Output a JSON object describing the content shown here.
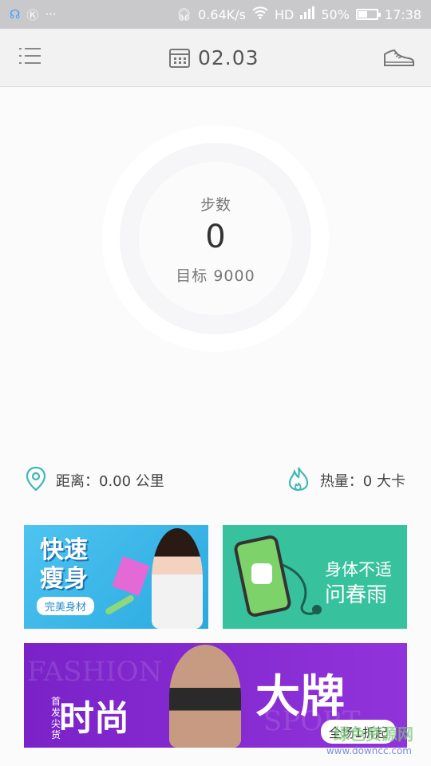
{
  "status_bar": {
    "left_icons": [
      "headset-status-icon",
      "k-icon",
      "more-dots-icon"
    ],
    "net_speed": "0.64K/s",
    "hd_label": "HD",
    "battery_pct": "50%",
    "battery_level": 0.5,
    "time": "17:38",
    "dots": "···"
  },
  "header": {
    "date": "02.03"
  },
  "steps": {
    "label": "步数",
    "value": "0",
    "goal": "目标 9000"
  },
  "stats": {
    "distance": "距离：0.00 公里",
    "calories": "热量：0 大卡"
  },
  "banners": {
    "b1": {
      "title_line1": "快速",
      "title_line2": "瘦身",
      "subtitle": "完美身材"
    },
    "b2": {
      "line1": "身体不适",
      "line2": "问春雨"
    },
    "b3": {
      "small": "首发尖货",
      "left": "时尚",
      "right": "大牌",
      "badge": "全场1折起",
      "bg1": "FASHION",
      "bg2": "SPORT"
    }
  },
  "watermark": {
    "text": "绿色资源网",
    "url": "www.downcc.com"
  },
  "colors": {
    "accent_teal": "#3fb8b8",
    "banner_green": "#37c29d",
    "banner_purple": "#8b2fd6",
    "banner_blue": "#2aa9e0"
  }
}
